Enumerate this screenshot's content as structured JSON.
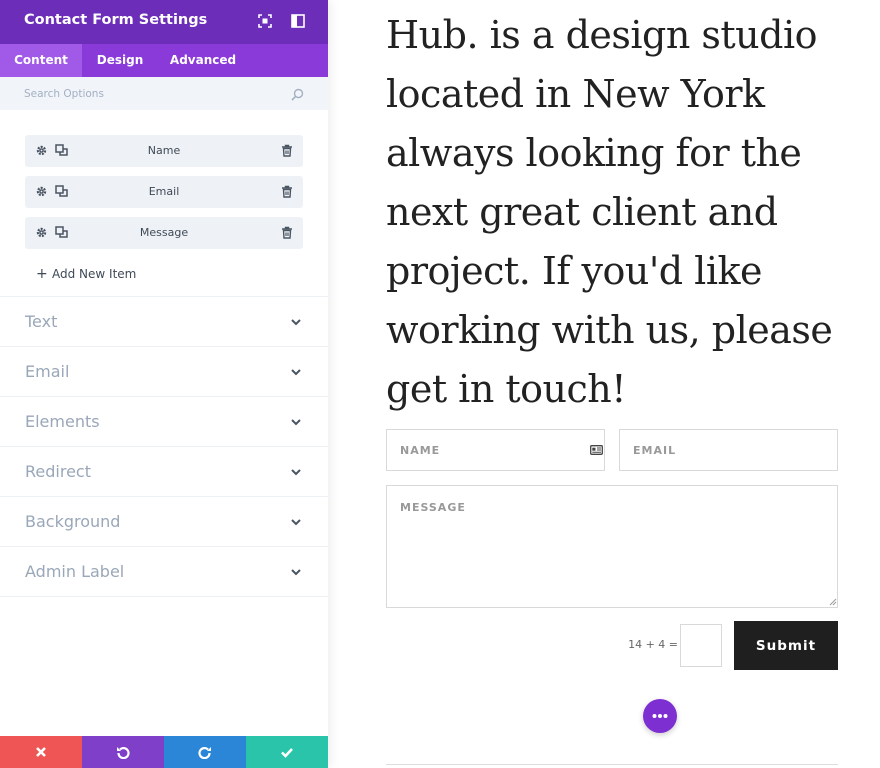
{
  "panel": {
    "title": "Contact Form Settings",
    "tabs": [
      {
        "label": "Content",
        "active": true
      },
      {
        "label": "Design",
        "active": false
      },
      {
        "label": "Advanced",
        "active": false
      }
    ],
    "search": {
      "placeholder": "Search Options"
    },
    "items": [
      {
        "label": "Name"
      },
      {
        "label": "Email"
      },
      {
        "label": "Message"
      }
    ],
    "add_item_label": "Add New Item",
    "sections": [
      {
        "label": "Text"
      },
      {
        "label": "Email"
      },
      {
        "label": "Elements"
      },
      {
        "label": "Redirect"
      },
      {
        "label": "Background"
      },
      {
        "label": "Admin Label"
      }
    ]
  },
  "page": {
    "headline": "Hub. is a design studio located in New York always looking for the next great client and project. If you'd like working with us, please get in touch!",
    "form": {
      "name_placeholder": "NAME",
      "email_placeholder": "EMAIL",
      "message_placeholder": "MESSAGE",
      "captcha_question": "14 + 4 =",
      "submit_label": "Submit"
    }
  },
  "colors": {
    "header": "#6c2eb9",
    "tabs": "#8a3ad8",
    "cancel": "#ef5555",
    "undo": "#7f3fc8",
    "redo": "#2c86d8",
    "save": "#29c4a9",
    "fab": "#7d2fd1"
  }
}
